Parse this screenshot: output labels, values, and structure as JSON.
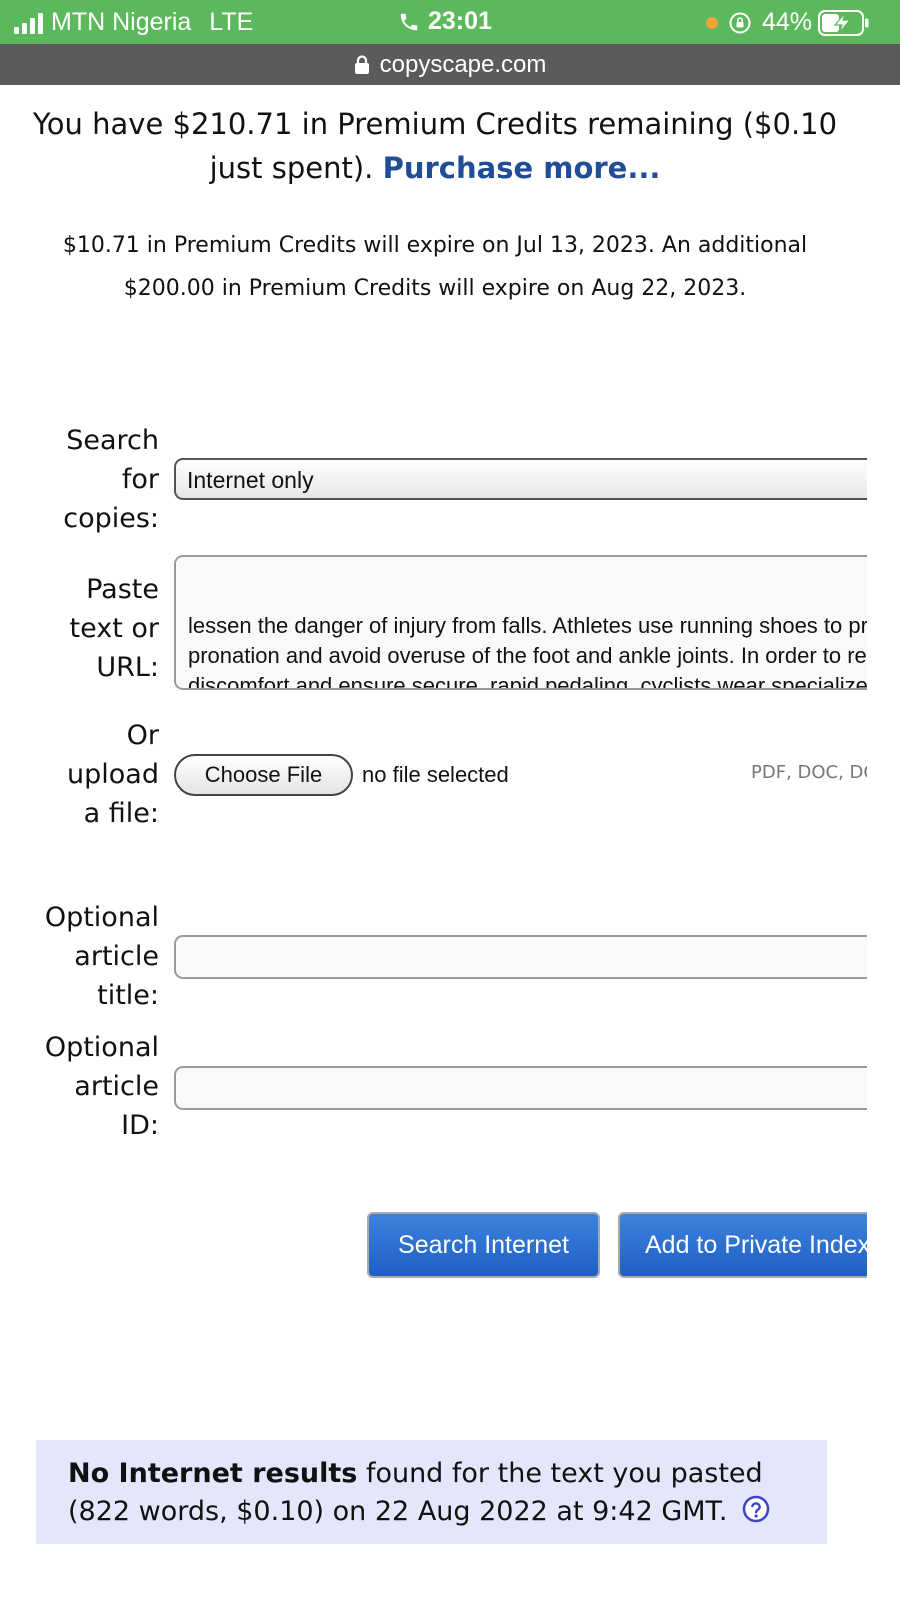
{
  "status_bar": {
    "carrier": "MTN Nigeria",
    "network": "LTE",
    "time": "23:01",
    "battery": "44%"
  },
  "url_bar": {
    "domain": "copyscape.com"
  },
  "credits": {
    "text": "You have $210.71 in Premium Credits remaining ($0.10 just spent).",
    "purchase_link": "Purchase more...",
    "expiry_text": "$10.71 in Premium Credits will expire on Jul 13, 2023. An additional $200.00 in Premium Credits will expire on Aug 22, 2023."
  },
  "form": {
    "search_label": "Search for copies:",
    "search_value": "Internet only",
    "paste_label": "Paste text or URL:",
    "paste_value": "lessen the danger of injury from falls. Athletes use running shoes to prevent\npronation and avoid overuse of the foot and ankle joints. In order to reduce\ndiscomfort and ensure secure, rapid pedaling, cyclists wear specialized\n\"cycling shoes.\"",
    "upload_label": "Or upload a file:",
    "choose_file_label": "Choose File",
    "file_status": "no file selected",
    "file_types": "PDF, DOC, DOCX",
    "title_label": "Optional article title:",
    "title_value": "",
    "id_label": "Optional article ID:",
    "id_value": ""
  },
  "buttons": {
    "search_internet": "Search Internet",
    "add_private": "Add to Private Index"
  },
  "result": {
    "bold": "No Internet results",
    "text": "found for the text you pasted (822 words, $0.10) on 22 Aug 2022 at 9:42 GMT."
  },
  "colors": {
    "status_bar": "#5cb85c",
    "url_bar": "#5b5b5b",
    "link": "#1f4e96",
    "button": "#2a6fd3",
    "result_bg": "#e4e6fb"
  }
}
